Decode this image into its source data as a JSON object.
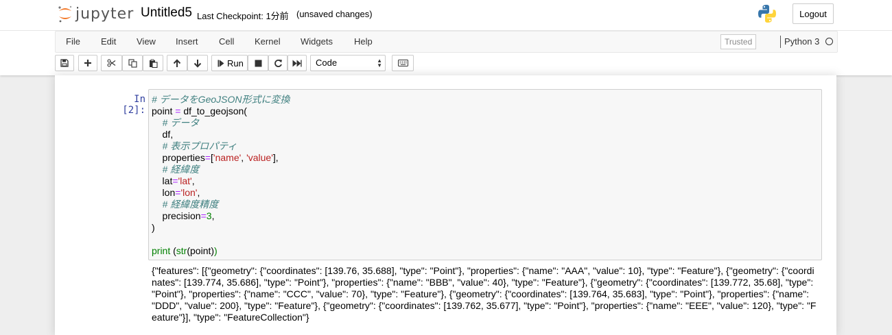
{
  "header": {
    "logo_text": "jupyter",
    "notebook_name": "Untitled5",
    "checkpoint": "Last Checkpoint: 1分前",
    "autosave_status": "(unsaved changes)",
    "logout_label": "Logout"
  },
  "menu": {
    "items": [
      "File",
      "Edit",
      "View",
      "Insert",
      "Cell",
      "Kernel",
      "Widgets",
      "Help"
    ],
    "trusted_label": "Trusted",
    "kernel_name": "Python 3"
  },
  "toolbar": {
    "run_label": "Run",
    "cell_type": "Code"
  },
  "cell": {
    "prompt": "In [2]:",
    "code": {
      "l1": "# データをGeoJSON形式に変換",
      "l2a": "point ",
      "l2b": "=",
      "l2c": " df_to_geojson(",
      "l3": "    # データ",
      "l4": "    df,",
      "l5": "    # 表示プロパティ",
      "l6a": "    properties",
      "l6b": "=",
      "l6c": "[",
      "l6d": "'name'",
      "l6e": ", ",
      "l6f": "'value'",
      "l6g": "],",
      "l7": "    # 経緯度",
      "l8a": "    lat",
      "l8b": "=",
      "l8c": "'lat'",
      "l8d": ",",
      "l9a": "    lon",
      "l9b": "=",
      "l9c": "'lon'",
      "l9d": ",",
      "l10": "    # 経緯度精度",
      "l11a": "    precision",
      "l11b": "=",
      "l11c": "3",
      "l11d": ",",
      "l12": ")",
      "l14a": "print",
      "l14b": " (",
      "l14c": "str",
      "l14d": "(point)",
      "l14e": ")"
    },
    "output": "{\"features\": [{\"geometry\": {\"coordinates\": [139.76, 35.688], \"type\": \"Point\"}, \"properties\": {\"name\": \"AAA\", \"value\": 10}, \"type\": \"Feature\"}, {\"geometry\": {\"coordinates\": [139.774, 35.686], \"type\": \"Point\"}, \"properties\": {\"name\": \"BBB\", \"value\": 40}, \"type\": \"Feature\"}, {\"geometry\": {\"coordinates\": [139.772, 35.68], \"type\": \"Point\"}, \"properties\": {\"name\": \"CCC\", \"value\": 70}, \"type\": \"Feature\"}, {\"geometry\": {\"coordinates\": [139.764, 35.683], \"type\": \"Point\"}, \"properties\": {\"name\": \"DDD\", \"value\": 200}, \"type\": \"Feature\"}, {\"geometry\": {\"coordinates\": [139.762, 35.677], \"type\": \"Point\"}, \"properties\": {\"name\": \"EEE\", \"value\": 120}, \"type\": \"Feature\"}], \"type\": \"FeatureCollection\"}"
  },
  "colors": {
    "prompt_in": "#303f9f",
    "comment": "#408080",
    "string": "#ba2121",
    "keyword_green": "#008000",
    "operator": "#aa22ff",
    "logo_orange": "#f37726"
  },
  "icons": {
    "save": "floppy-disk-icon",
    "add": "plus-icon",
    "cut": "scissors-icon",
    "copy": "copy-icon",
    "paste": "paste-icon",
    "up": "arrow-up-icon",
    "down": "arrow-down-icon",
    "run": "step-forward-icon",
    "stop": "stop-icon",
    "restart": "restart-icon",
    "fast_forward": "fast-forward-icon",
    "keyboard": "keyboard-icon",
    "python": "python-logo-icon",
    "kernel_status": "kernel-idle-circle-icon"
  }
}
